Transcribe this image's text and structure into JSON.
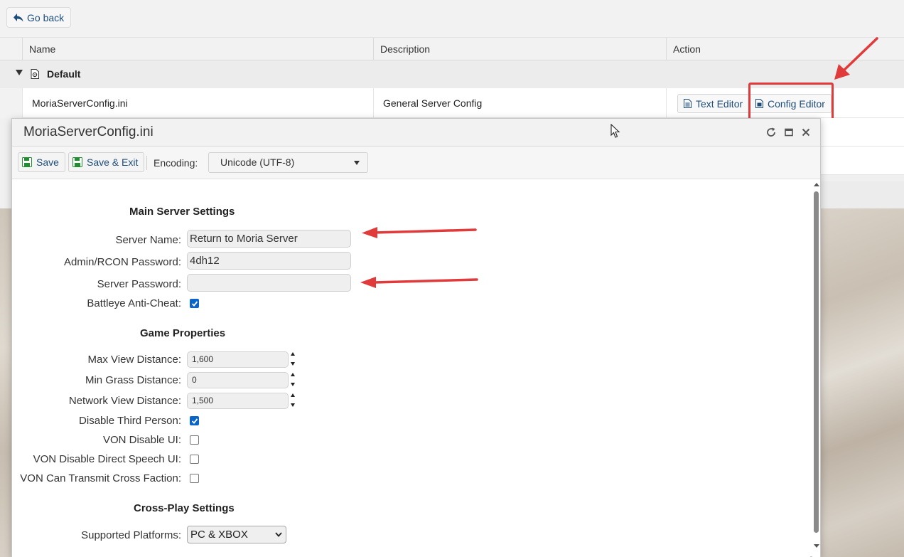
{
  "page": {
    "go_back": "Go back",
    "columns": [
      "Name",
      "Description",
      "Action"
    ],
    "group": {
      "label": "Default"
    },
    "file": {
      "name": "MoriaServerConfig.ini",
      "description": "General Server Config",
      "text_editor": "Text Editor",
      "config_editor": "Config Editor"
    }
  },
  "dialog": {
    "title": "MoriaServerConfig.ini",
    "toolbar": {
      "save": "Save",
      "save_exit": "Save & Exit",
      "encoding_label": "Encoding:",
      "encoding_value": "Unicode (UTF-8)"
    },
    "sections": {
      "main": "Main Server Settings",
      "game": "Game Properties",
      "crossplay": "Cross-Play Settings"
    },
    "main": {
      "server_name": {
        "label": "Server Name:",
        "value": "Return to Moria Server"
      },
      "admin_password": {
        "label": "Admin/RCON Password:",
        "value": "4dh12"
      },
      "server_password": {
        "label": "Server Password:",
        "value": ""
      },
      "battleye": {
        "label": "Battleye Anti-Cheat:",
        "checked": true
      }
    },
    "game": {
      "max_view": {
        "label": "Max View Distance:",
        "value": "1,600"
      },
      "min_grass": {
        "label": "Min Grass Distance:",
        "value": "0"
      },
      "network_view": {
        "label": "Network View Distance:",
        "value": "1,500"
      },
      "disable_third_person": {
        "label": "Disable Third Person:",
        "checked": true
      },
      "von_disable_ui": {
        "label": "VON Disable UI:",
        "checked": false
      },
      "von_disable_direct": {
        "label": "VON Disable Direct Speech UI:",
        "checked": false
      },
      "von_cross_faction": {
        "label": "VON Can Transmit Cross Faction:",
        "checked": false
      }
    },
    "crossplay": {
      "platforms": {
        "label": "Supported Platforms:",
        "value": "PC & XBOX"
      }
    }
  },
  "colors": {
    "link": "#1e4d7b",
    "annotation": "#e03a3a",
    "checkbox": "#0b64c9"
  }
}
